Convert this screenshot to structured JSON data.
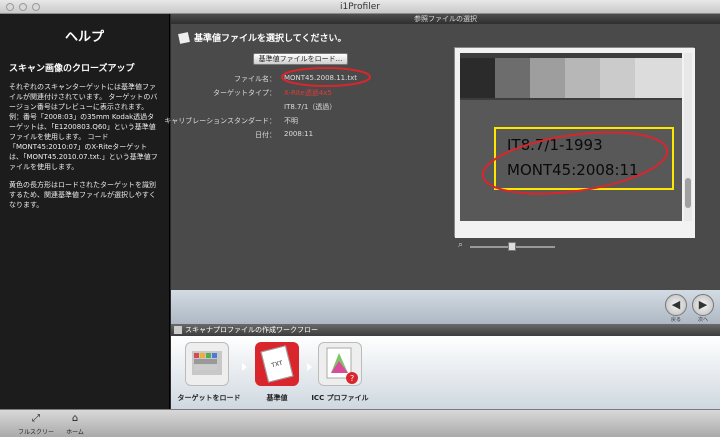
{
  "window": {
    "title": "i1Profiler"
  },
  "header": {
    "title": "参照ファイルの選択"
  },
  "help": {
    "title": "ヘルプ",
    "subtitle": "スキャン画像のクローズアップ",
    "paragraph1": "それぞれのスキャンターゲットには基準値ファイルが関連付けされています。 ターゲットのバージョン番号はプレビューに表示されます。例：番号「2008:03」の35mm Kodak透過ターゲットは、「E1200803.Q60」という基準値ファイルを使用します。 コード「MONT45:2010:07」のX-Riteターゲットは、「MONT45.2010.07.txt.」という基準値ファイルを使用します。",
    "paragraph2": "黄色の長方形はロードされたターゲットを識別するため、関連基準値ファイルが選択しやすくなります。"
  },
  "main": {
    "section_title": "基準値ファイルを選択してください。",
    "load_button": "基準値ファイルをロード...",
    "fields": [
      {
        "label": "ファイル名：",
        "value": "MONT45.2008.11.txt"
      },
      {
        "label": "ターゲットタイプ：",
        "value": "X-Rite透過4x5"
      },
      {
        "label": "",
        "value": "IT8.7/1（透過）"
      },
      {
        "label": "キャリブレーションスタンダード：",
        "value": "不明"
      },
      {
        "label": "日付：",
        "value": "2008:11"
      }
    ],
    "preview_text_line1": "IT8.7/1-1993",
    "preview_text_line2": "MONT45:2008:11"
  },
  "nav": {
    "back_label": "戻る",
    "next_label": "次へ"
  },
  "workflow": {
    "title": "スキャナプロファイルの作成ワークフロー",
    "steps": [
      {
        "label": "ターゲットをロード"
      },
      {
        "label": "基準値",
        "icon_text": "TXT"
      },
      {
        "label": "ICC プロファイル"
      }
    ]
  },
  "bottom": {
    "fullscreen_label": "フルスクリーン",
    "home_label": "ホーム"
  },
  "colors": {
    "accent_red": "#d9262c",
    "highlight_yellow": "#ffe600",
    "target_type_red": "#e23b3b"
  }
}
